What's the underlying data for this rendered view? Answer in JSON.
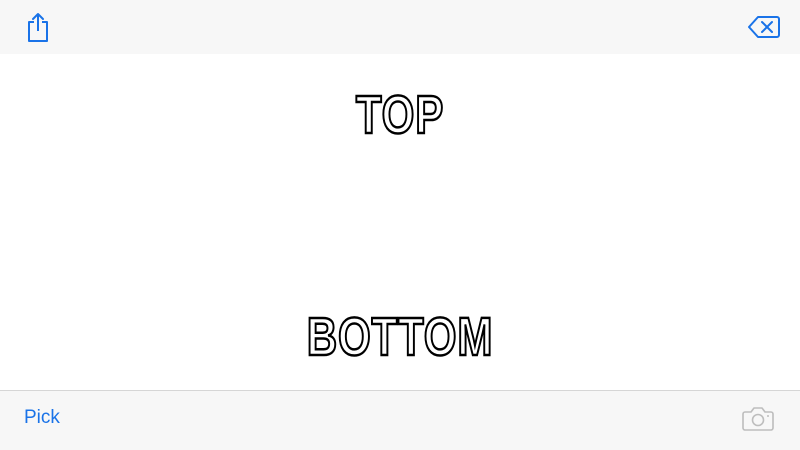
{
  "toolbar": {
    "share_icon": "share-icon",
    "clear_icon": "delete-backspace-icon"
  },
  "meme": {
    "top_text": "TOP",
    "bottom_text": "BOTTOM"
  },
  "bottom_bar": {
    "pick_label": "Pick",
    "camera_icon": "camera-icon"
  },
  "colors": {
    "accent": "#1a73e8",
    "bar_background": "#f7f7f7",
    "disabled_icon": "#bdbdbd"
  }
}
